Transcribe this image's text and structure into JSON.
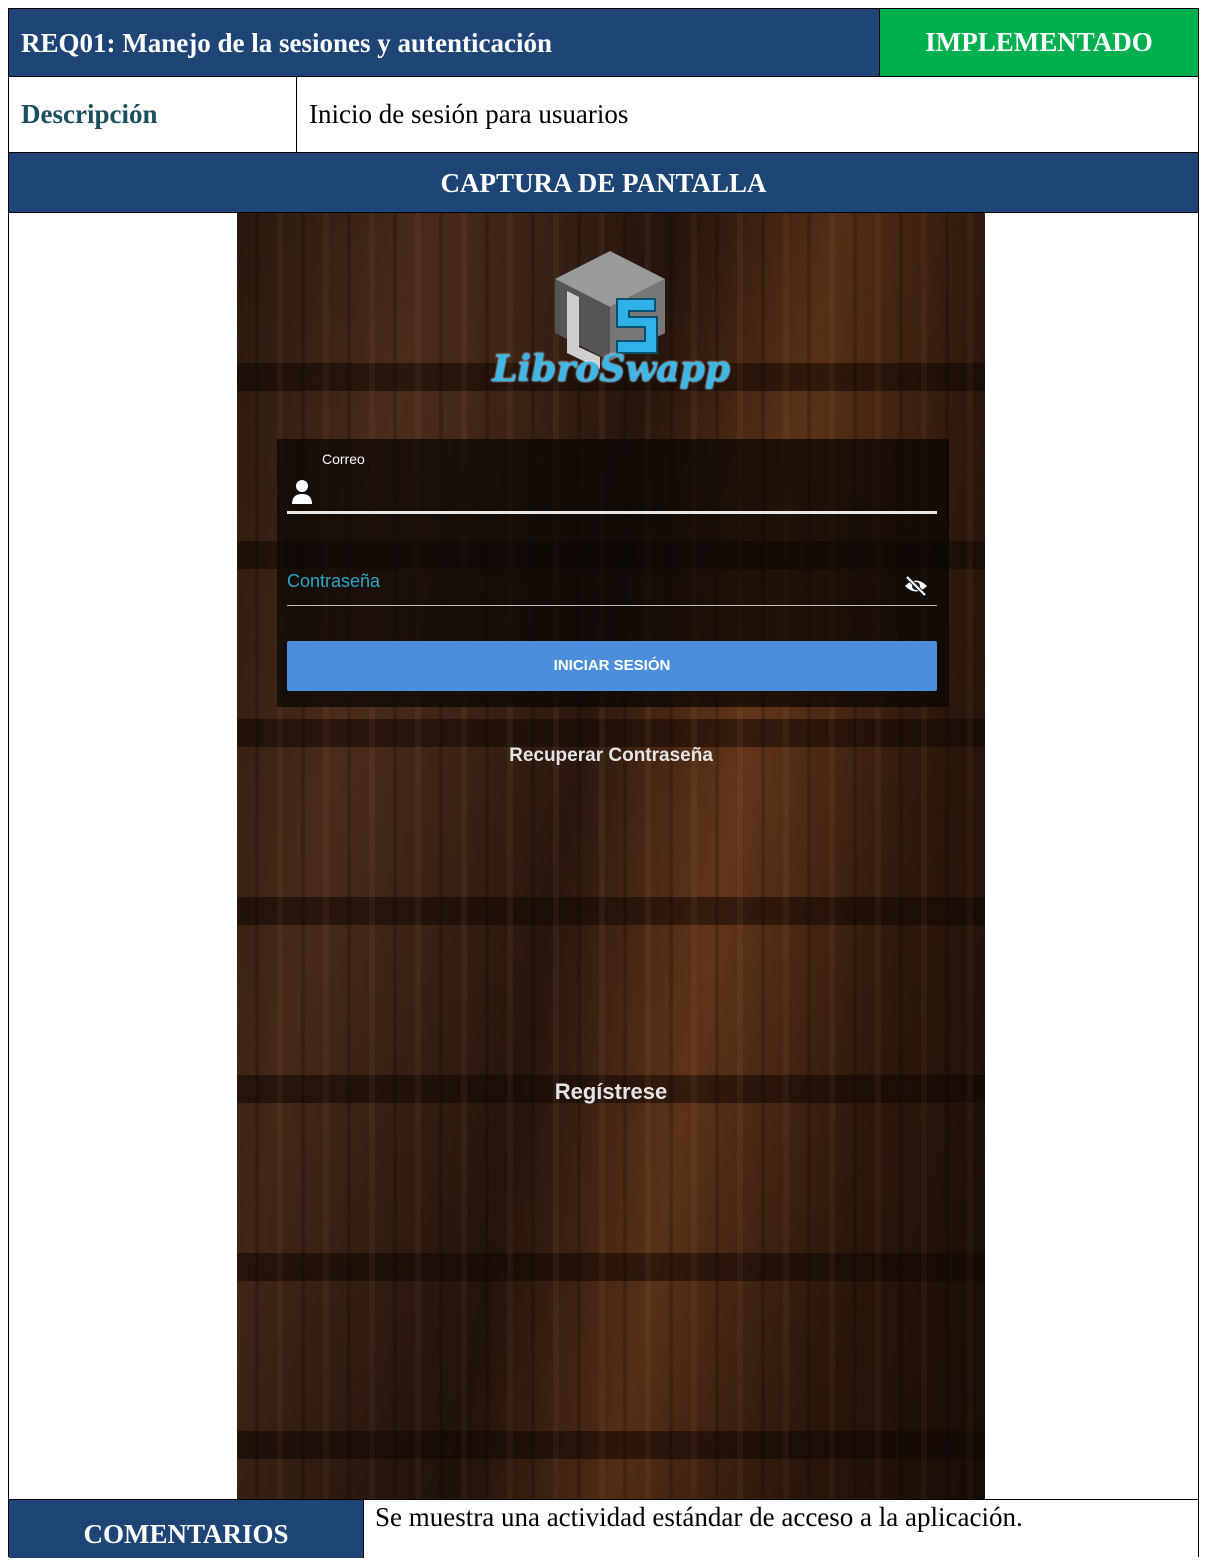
{
  "header": {
    "title": "REQ01: Manejo de la sesiones y autenticación",
    "status": "IMPLEMENTADO",
    "status_color": "#00b04f",
    "header_color": "#1f4577"
  },
  "description": {
    "label": "Descripción",
    "value": "Inicio de sesión para usuarios"
  },
  "screenshot_section": {
    "title": "CAPTURA DE PANTALLA"
  },
  "app": {
    "logo_text": "LibroSwapp",
    "email_label": "Correo",
    "password_placeholder": "Contraseña",
    "login_button": "INICIAR SESIÓN",
    "recover_link": "Recuperar Contraseña",
    "register_link": "Regístrese",
    "accent_color": "#4a8edc",
    "icons": [
      "user-icon",
      "eye-off-icon"
    ]
  },
  "comments": {
    "label": "COMENTARIOS",
    "value": "Se muestra una actividad estándar de acceso a la aplicación."
  }
}
